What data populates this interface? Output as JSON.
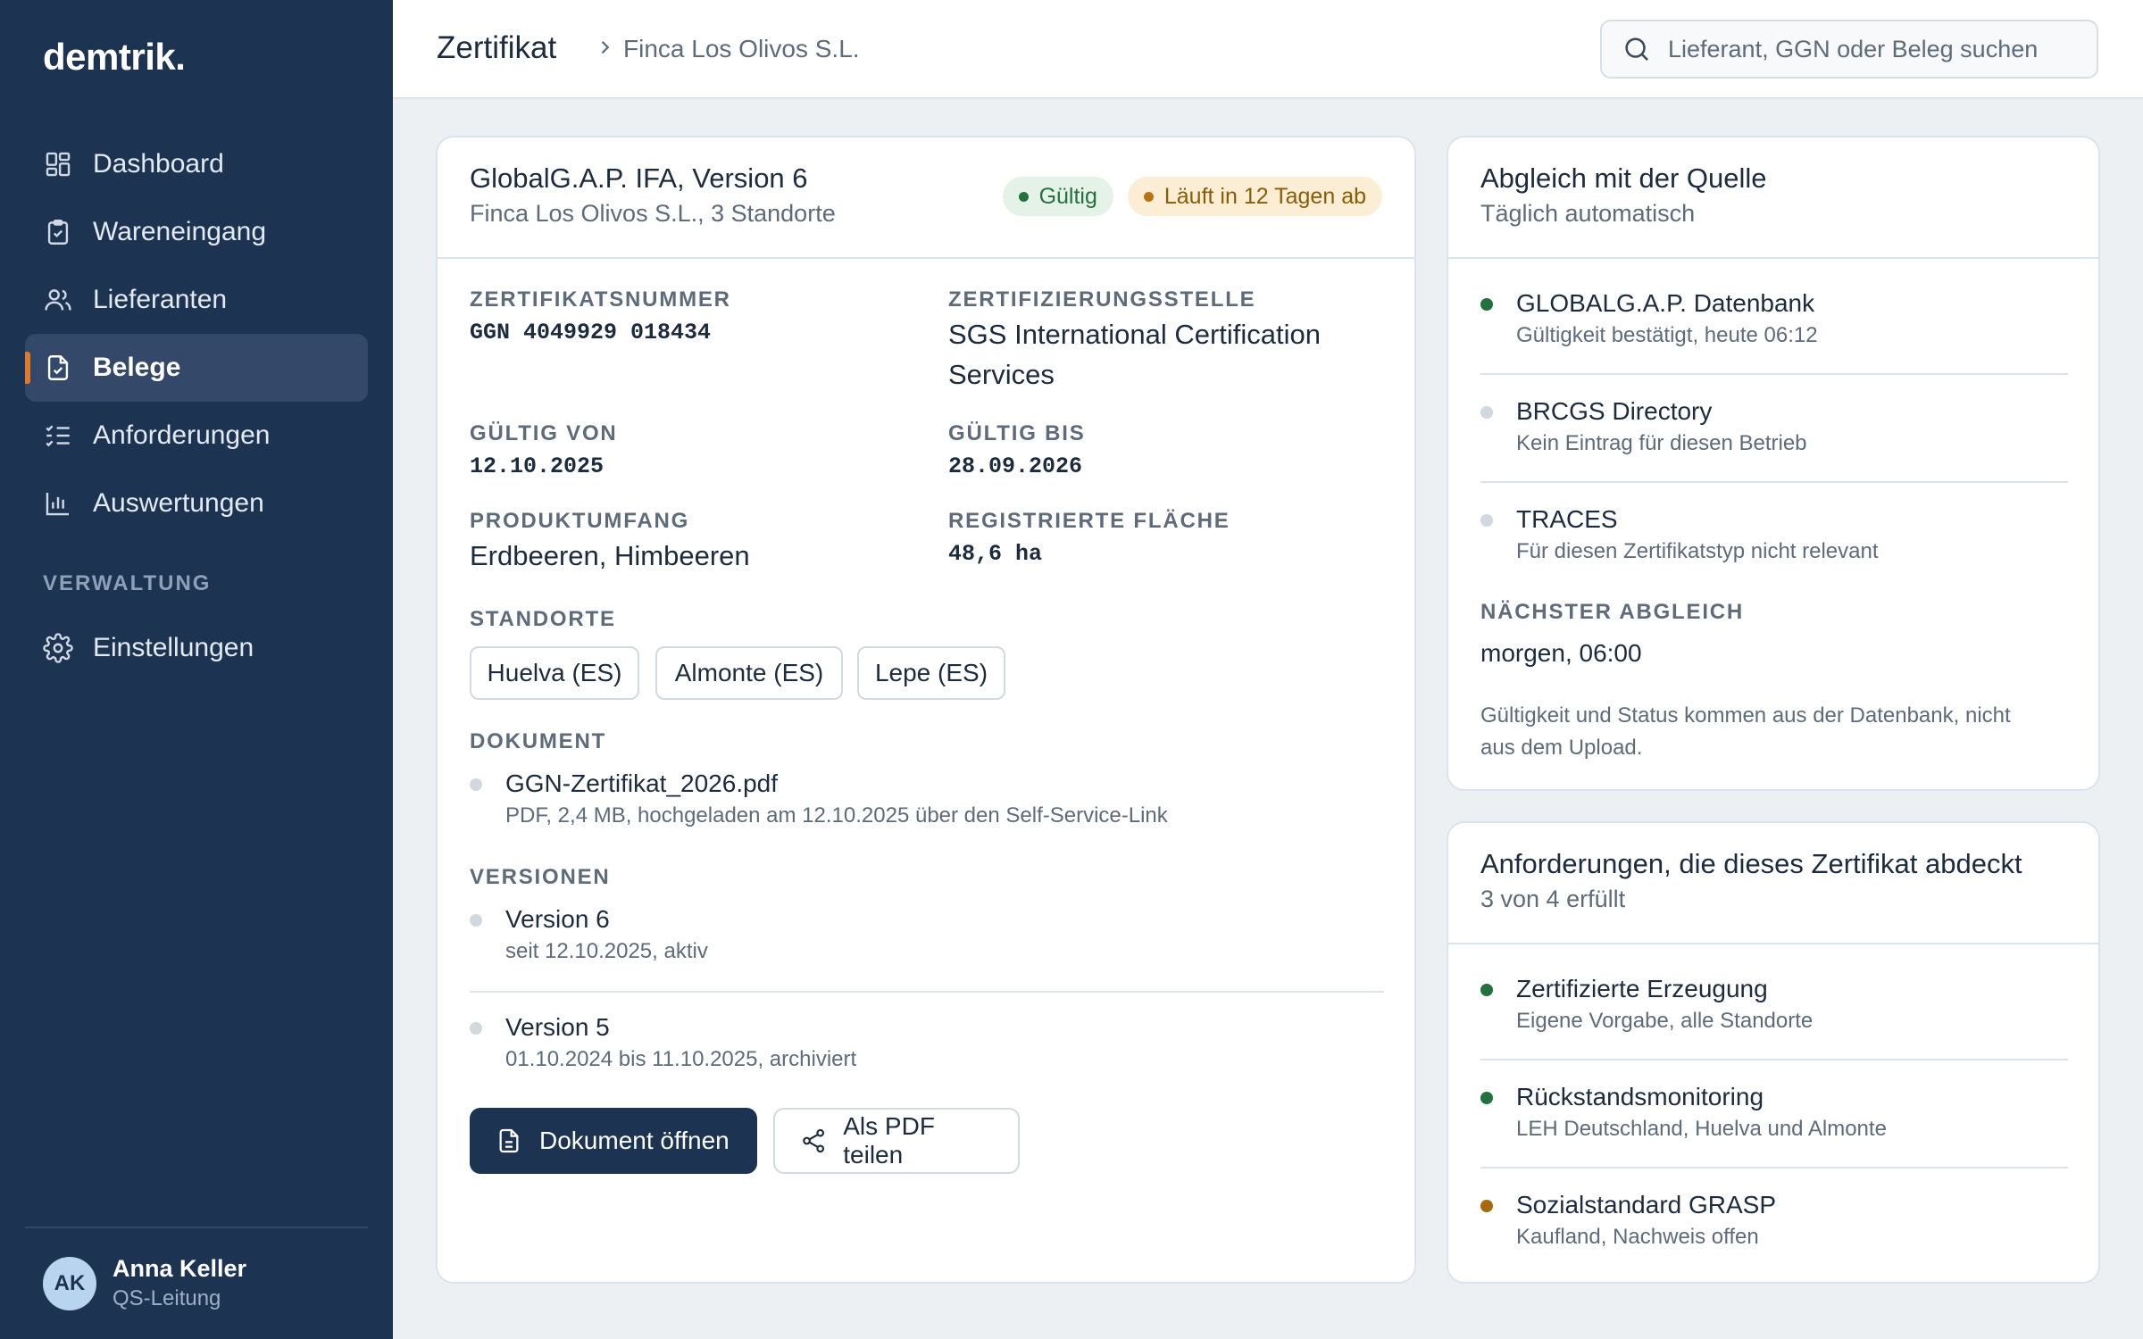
{
  "app": {
    "logo": "demtrik."
  },
  "sidebar": {
    "items": [
      {
        "label": "Dashboard",
        "icon": "dashboard-icon"
      },
      {
        "label": "Wareneingang",
        "icon": "clipboard-check-icon"
      },
      {
        "label": "Lieferanten",
        "icon": "users-icon"
      },
      {
        "label": "Belege",
        "icon": "document-check-icon",
        "active": true
      },
      {
        "label": "Anforderungen",
        "icon": "checklist-icon"
      },
      {
        "label": "Auswertungen",
        "icon": "bar-chart-icon"
      }
    ],
    "section_label": "VERWALTUNG",
    "admin_items": [
      {
        "label": "Einstellungen",
        "icon": "gear-icon"
      }
    ],
    "user": {
      "initials": "AK",
      "name": "Anna Keller",
      "role": "QS-Leitung"
    }
  },
  "header": {
    "title": "Zertifikat",
    "breadcrumb": "Finca Los Olivos S.L.",
    "search_placeholder": "Lieferant, GGN oder Beleg suchen"
  },
  "certificate": {
    "title": "GlobalG.A.P. IFA, Version 6",
    "subtitle": "Finca Los Olivos S.L., 3 Standorte",
    "badge_valid": "Gültig",
    "badge_expiry": "Läuft in 12 Tagen ab",
    "number_label": "ZERTIFIKATSNUMMER",
    "number": "GGN 4049929 018434",
    "body_label": "ZERTIFIZIERUNGSSTELLE",
    "body_line1": "SGS International Certification",
    "body_line2": "Services",
    "valid_from_label": "GÜLTIG VON",
    "valid_from": "12.10.2025",
    "valid_to_label": "GÜLTIG BIS",
    "valid_to": "28.09.2026",
    "scope_label": "PRODUKTUMFANG",
    "scope": "Erdbeeren, Himbeeren",
    "area_label": "REGISTRIERTE FLÄCHE",
    "area": "48,6 ha",
    "sites_label": "STANDORTE",
    "sites": [
      "Huelva (ES)",
      "Almonte (ES)",
      "Lepe (ES)"
    ],
    "document_label": "DOKUMENT",
    "document_name": "GGN-Zertifikat_2026.pdf",
    "document_meta": "PDF, 2,4 MB, hochgeladen am 12.10.2025 über den Self-Service-Link",
    "versions_label": "VERSIONEN",
    "versions": [
      {
        "title": "Version 6",
        "sub": "seit 12.10.2025, aktiv"
      },
      {
        "title": "Version 5",
        "sub": "01.10.2024 bis 11.10.2025, archiviert"
      }
    ],
    "btn_open": "Dokument öffnen",
    "btn_share": "Als PDF teilen"
  },
  "source": {
    "title": "Abgleich mit der Quelle",
    "subtitle": "Täglich automatisch",
    "items": [
      {
        "title": "GLOBALG.A.P. Datenbank",
        "sub": "Gültigkeit bestätigt, heute 06:12",
        "status": "#24703f"
      },
      {
        "title": "BRCGS Directory",
        "sub": "Kein Eintrag für diesen Betrieb",
        "status": "#d1d8e0"
      },
      {
        "title": "TRACES",
        "sub": "Für diesen Zertifikatstyp nicht relevant",
        "status": "#d1d8e0"
      }
    ],
    "next_label": "NÄCHSTER ABGLEICH",
    "next_value": "morgen, 06:00",
    "note_line1": "Gültigkeit und Status kommen aus der Datenbank, nicht",
    "note_line2": "aus dem Upload."
  },
  "requirements": {
    "title": "Anforderungen, die dieses Zertifikat abdeckt",
    "subtitle": "3 von 4 erfüllt",
    "items": [
      {
        "title": "Zertifizierte Erzeugung",
        "sub": "Eigene Vorgabe, alle Standorte",
        "status": "#24703f"
      },
      {
        "title": "Rückstandsmonitoring",
        "sub": "LEH Deutschland, Huelva und Almonte",
        "status": "#24703f"
      },
      {
        "title": "Sozialstandard GRASP",
        "sub": "Kaufland, Nachweis offen",
        "status": "#a8680f"
      }
    ]
  }
}
